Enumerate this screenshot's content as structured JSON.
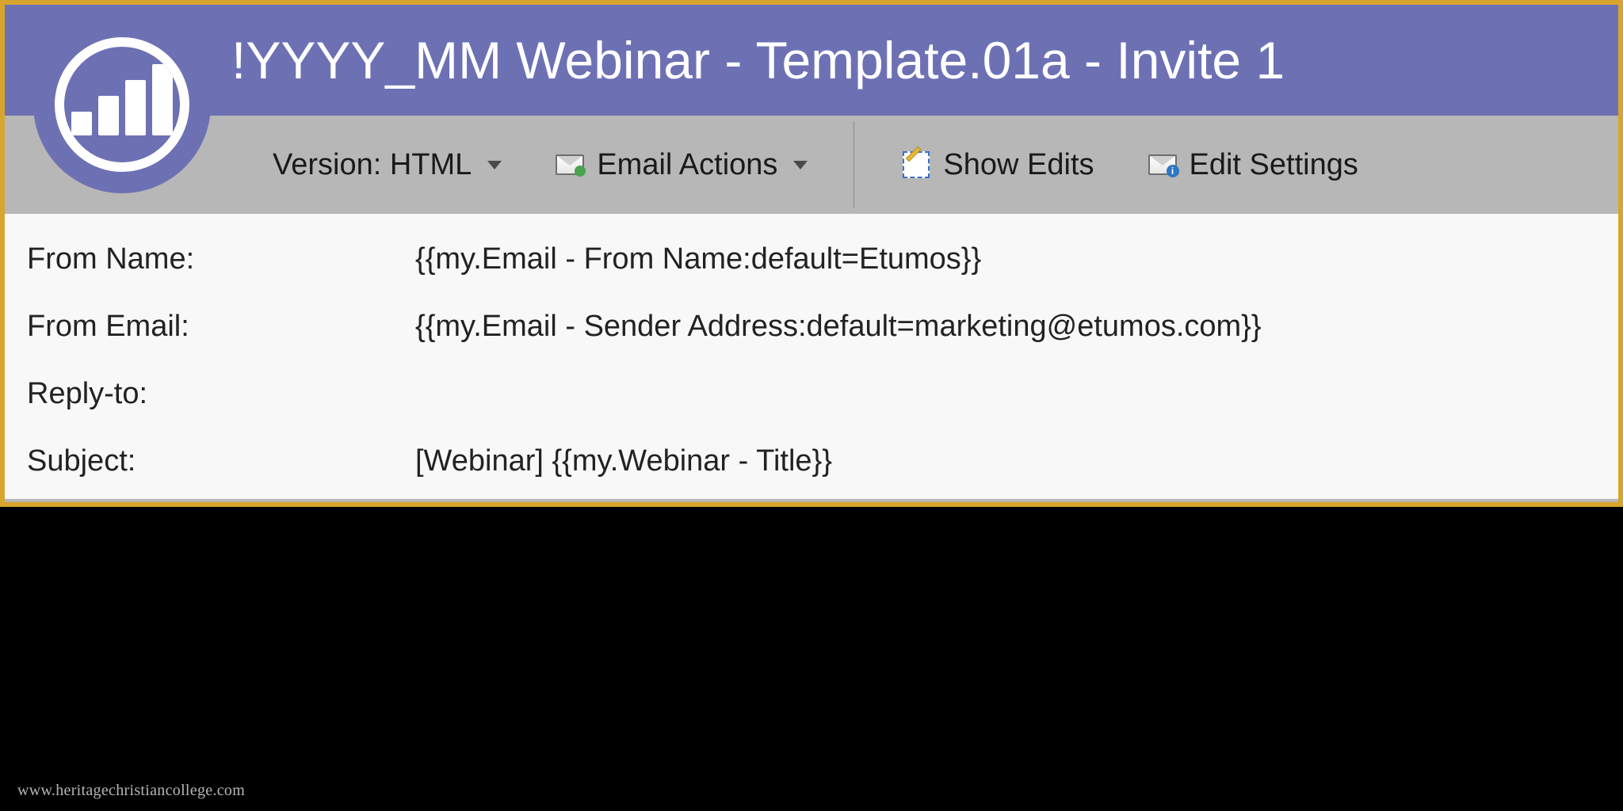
{
  "header": {
    "title": "!YYYY_MM Webinar - Template.01a - Invite 1"
  },
  "toolbar": {
    "version_label": "Version: HTML",
    "email_actions_label": "Email Actions",
    "show_edits_label": "Show Edits",
    "edit_settings_label": "Edit Settings"
  },
  "fields": {
    "from_name": {
      "label": "From Name:",
      "value": "{{my.Email - From Name:default=Etumos}}"
    },
    "from_email": {
      "label": "From Email:",
      "value": "{{my.Email - Sender Address:default=marketing@etumos.com}}"
    },
    "reply_to": {
      "label": "Reply-to:",
      "value": ""
    },
    "subject": {
      "label": "Subject:",
      "value": "[Webinar] {{my.Webinar - Title}}"
    }
  },
  "watermark": "www.heritagechristiancollege.com",
  "colors": {
    "brand_purple": "#6d71b4",
    "frame_gold": "#d7a52e",
    "toolbar_grey": "#b7b7b7"
  }
}
